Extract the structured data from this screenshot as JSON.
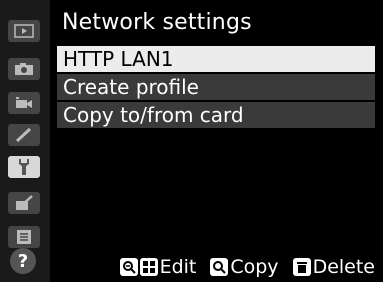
{
  "title": "Network settings",
  "menu": {
    "items": [
      "HTTP LAN1",
      "Create profile",
      "Copy to/from card"
    ],
    "selected_index": 0
  },
  "footer": {
    "edit_label": "Edit",
    "copy_label": "Copy",
    "delete_label": "Delete"
  },
  "sidebar": {
    "tabs": [
      "playback-icon",
      "camera-icon",
      "movie-icon",
      "pencil-icon",
      "wrench-icon",
      "retouch-icon",
      "my-menu-icon"
    ],
    "active_tab": "wrench-icon",
    "help_label": "?"
  },
  "colors": {
    "background": "#000000",
    "sidebar": "#1a1a1a",
    "row": "#3a3a3a",
    "row_selected": "#ececec"
  }
}
